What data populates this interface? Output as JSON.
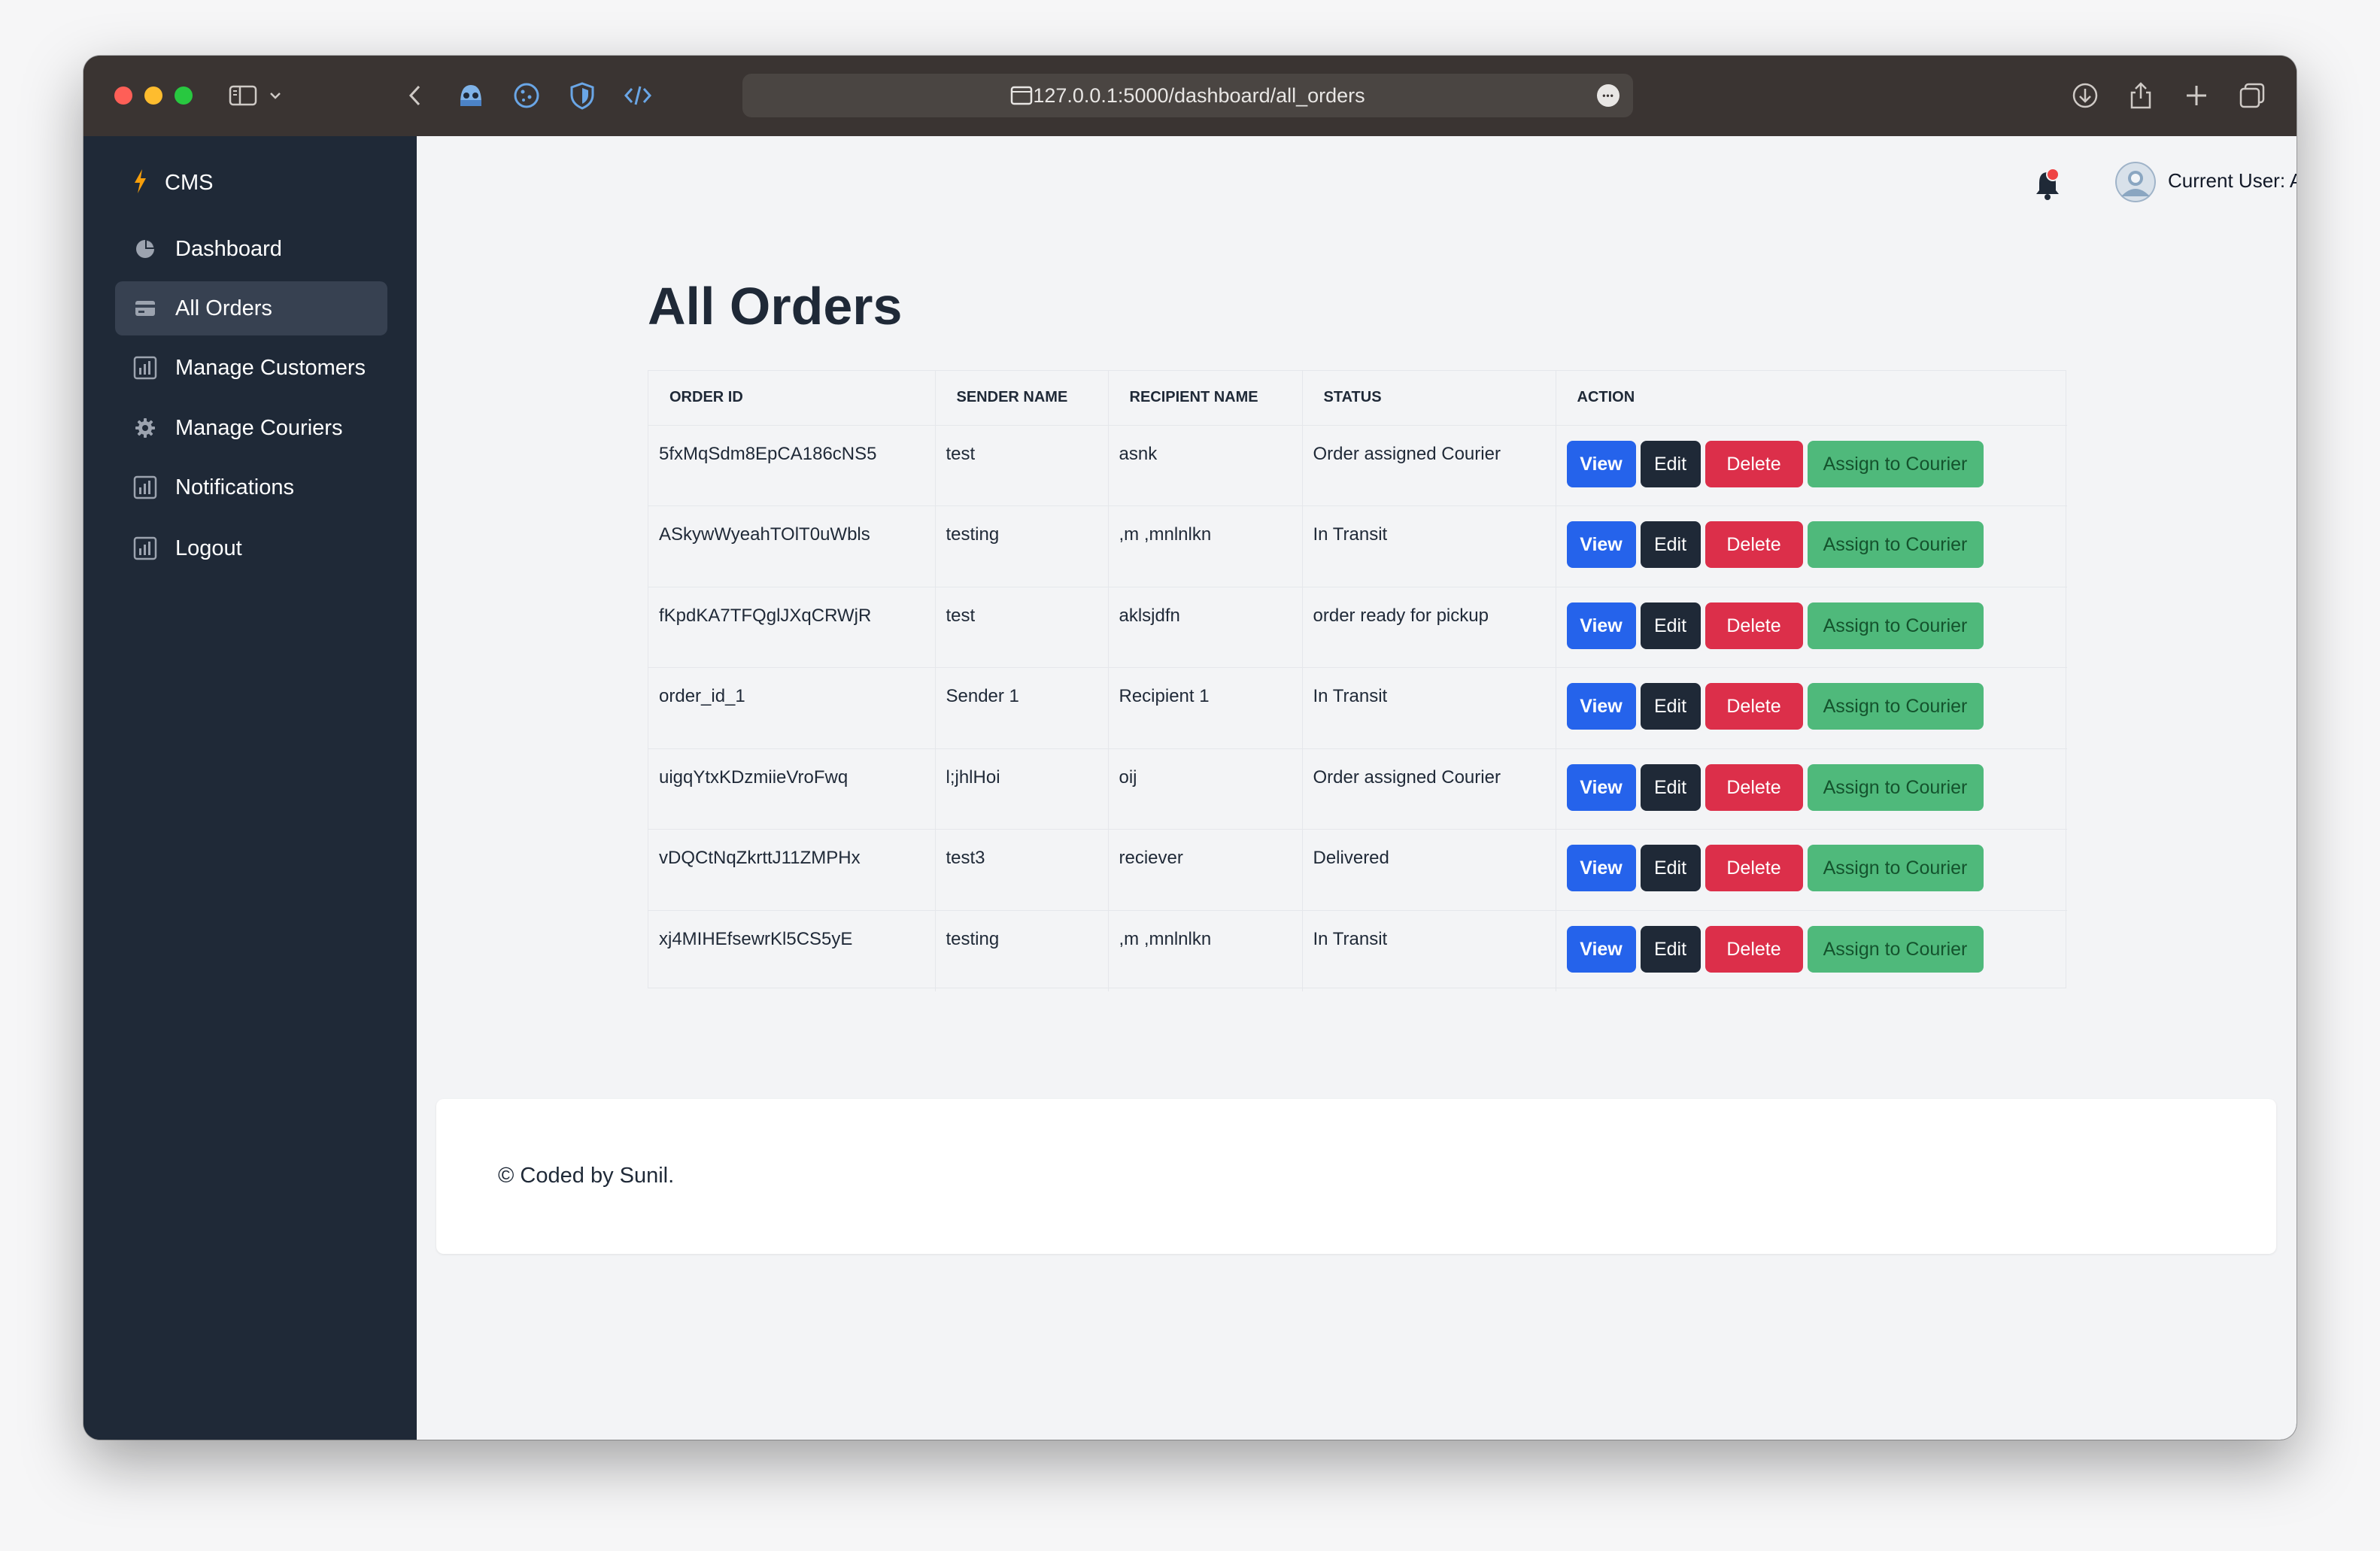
{
  "browser": {
    "url": "127.0.0.1:5000/dashboard/all_orders",
    "more_glyph": "•••"
  },
  "sidebar": {
    "brand": "CMS",
    "items": [
      {
        "label": "Dashboard",
        "icon": "pie-chart-icon"
      },
      {
        "label": "All Orders",
        "icon": "credit-card-icon",
        "active": true
      },
      {
        "label": "Manage Customers",
        "icon": "bar-chart-icon"
      },
      {
        "label": "Manage Couriers",
        "icon": "gear-icon"
      },
      {
        "label": "Notifications",
        "icon": "bar-chart-icon"
      },
      {
        "label": "Logout",
        "icon": "bar-chart-icon"
      }
    ]
  },
  "header": {
    "user_label": "Current User: ADMIN"
  },
  "main": {
    "title": "All Orders",
    "columns": [
      "ORDER ID",
      "SENDER NAME",
      "RECIPIENT NAME",
      "STATUS",
      "ACTION"
    ],
    "rows": [
      {
        "order_id": "5fxMqSdm8EpCA186cNS5",
        "sender": "test",
        "recipient": "asnk",
        "status": "Order assigned Courier"
      },
      {
        "order_id": "ASkywWyeahTOlT0uWbls",
        "sender": "testing",
        "recipient": ",m ,mnlnlkn",
        "status": "In Transit"
      },
      {
        "order_id": "fKpdKA7TFQglJXqCRWjR",
        "sender": "test",
        "recipient": "aklsjdfn",
        "status": "order ready for pickup"
      },
      {
        "order_id": "order_id_1",
        "sender": "Sender 1",
        "recipient": "Recipient 1",
        "status": "In Transit"
      },
      {
        "order_id": "uigqYtxKDzmiieVroFwq",
        "sender": "l;jhlHoi",
        "recipient": "oij",
        "status": "Order assigned Courier"
      },
      {
        "order_id": "vDQCtNqZkrttJ11ZMPHx",
        "sender": "test3",
        "recipient": "reciever",
        "status": "Delivered"
      },
      {
        "order_id": "xj4MIHEfsewrKl5CS5yE",
        "sender": "testing",
        "recipient": ",m ,mnlnlkn",
        "status": "In Transit"
      }
    ],
    "actions": {
      "view": "View",
      "edit": "Edit",
      "delete": "Delete",
      "assign": "Assign to Courier"
    }
  },
  "footer": {
    "text": "© Coded by Sunil."
  },
  "colors": {
    "sidebar_bg": "#1f2937",
    "view": "#2563eb",
    "edit": "#1f2937",
    "delete": "#dc2f4a",
    "assign": "#4fb97b",
    "notification_dot": "#ef4444"
  }
}
